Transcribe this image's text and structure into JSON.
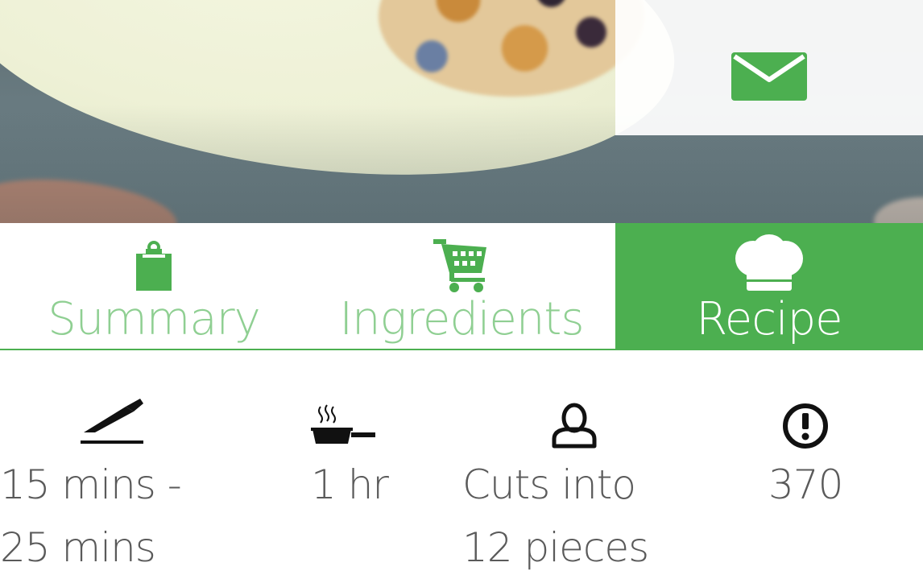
{
  "colors": {
    "accent": "#4caf50",
    "tab_label_inactive": "#8fcf92",
    "stat_text": "#5a5a5a"
  },
  "hero": {
    "action_icon": "envelope-icon"
  },
  "tabs": [
    {
      "label": "Summary",
      "icon": "clipboard-icon",
      "active": false
    },
    {
      "label": "Ingredients",
      "icon": "shopping-cart-icon",
      "active": false
    },
    {
      "label": "Recipe",
      "icon": "chef-hat-icon",
      "active": true
    }
  ],
  "stats": {
    "prep": {
      "icon": "knife-icon",
      "line1": "15 mins -",
      "line2": "25 mins"
    },
    "cook": {
      "icon": "frying-pan-icon",
      "line1": "1 hr"
    },
    "serves": {
      "icon": "person-icon",
      "line1": "Cuts into",
      "line2": "12 pieces"
    },
    "calories": {
      "icon": "alert-circle-icon",
      "line1": "370"
    }
  }
}
